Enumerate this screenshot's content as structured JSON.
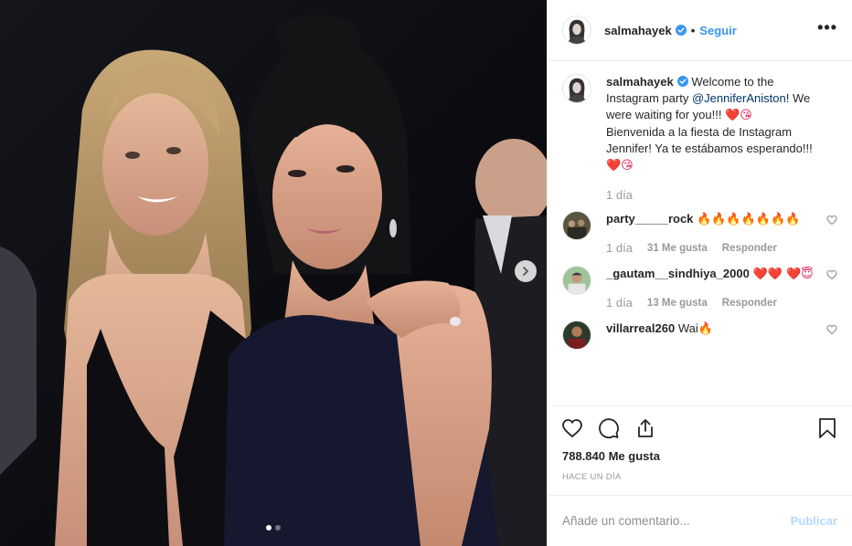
{
  "post": {
    "author": "salmahayek",
    "follow_separator": "•",
    "follow_label": "Seguir",
    "more_label": "•••",
    "carousel": {
      "current_slide": 1,
      "total_slides": 2
    },
    "icons": {
      "verified": "verified-badge-icon",
      "next": "chevron-right-icon",
      "like": "heart-icon",
      "comment": "comment-icon",
      "share": "share-icon",
      "save": "bookmark-icon"
    },
    "colors": {
      "accent": "#3897f0",
      "publish_disabled": "#b3dbff",
      "muted": "#999999",
      "text": "#262626"
    }
  },
  "caption": {
    "username": "salmahayek",
    "text_before_mention": "Welcome to the Instagram party ",
    "mention": "@JenniferAniston",
    "text_after_mention": "! We were waiting for you!!! ",
    "emoji_1": "❤️😘",
    "text_spanish": "Bienvenida a la fiesta de Instagram Jennifer! Ya te estábamos esperando!!! ",
    "emoji_2": "❤️😘",
    "time": "1 día"
  },
  "comments": [
    {
      "username": "party_____rock",
      "text": "",
      "emoji": "🔥🔥🔥🔥🔥🔥🔥",
      "time": "1 día",
      "likes": "31 Me gusta",
      "reply": "Responder"
    },
    {
      "username": "_gautam__sindhiya_2000",
      "text": "",
      "emoji": "❤️❤️ ❤️😇",
      "time": "1 día",
      "likes": "13 Me gusta",
      "reply": "Responder"
    },
    {
      "username": "villarreal260",
      "text": "Wai",
      "emoji": "🔥",
      "time": "",
      "likes": "",
      "reply": ""
    }
  ],
  "engagement": {
    "likes": "788.840 Me gusta",
    "time_ago": "HACE UN DÍA"
  },
  "add_comment": {
    "placeholder": "Añade un comentario...",
    "publish_label": "Publicar"
  }
}
